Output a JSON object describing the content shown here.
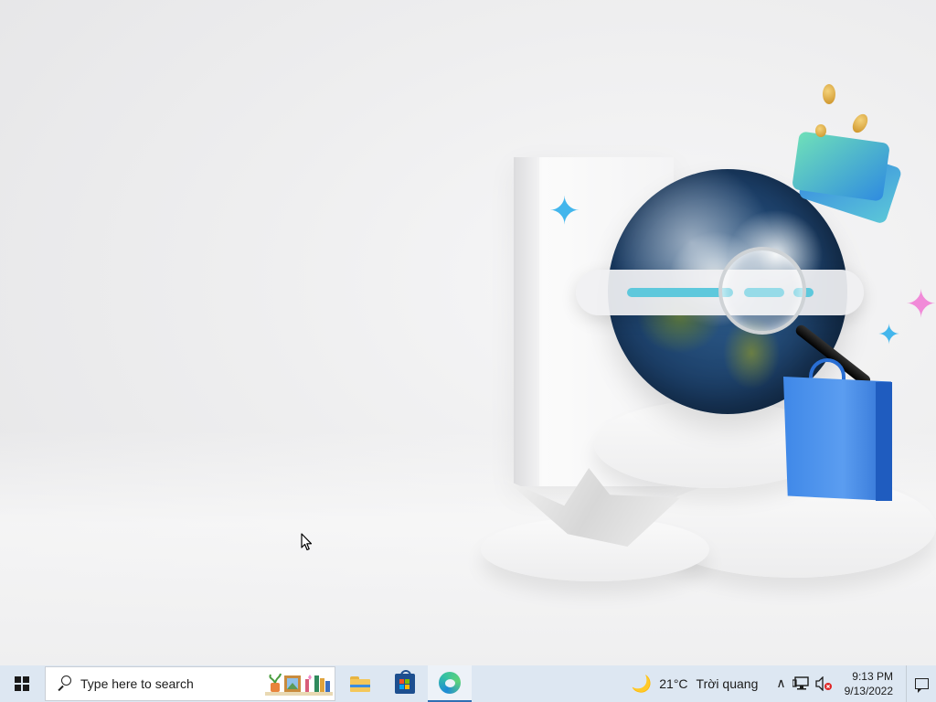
{
  "taskbar": {
    "search_placeholder": "Type here to search",
    "apps": [
      {
        "name": "File Explorer",
        "icon": "folder-icon"
      },
      {
        "name": "Microsoft Store",
        "icon": "store-icon"
      },
      {
        "name": "Microsoft Edge",
        "icon": "edge-icon",
        "active": true
      }
    ],
    "weather": {
      "icon": "moon-icon",
      "temperature": "21°C",
      "condition": "Trời quang"
    },
    "tray_icons": [
      "chevron-up-icon",
      "network-icon",
      "volume-muted-icon"
    ],
    "clock": {
      "time": "9:13 PM",
      "date": "9/13/2022"
    }
  },
  "colors": {
    "taskbar_bg": "#dde7f2",
    "accent_blue": "#2f6fb3",
    "cyan_dash": "#5ec8dc",
    "bag_blue": "#3f88e8"
  }
}
